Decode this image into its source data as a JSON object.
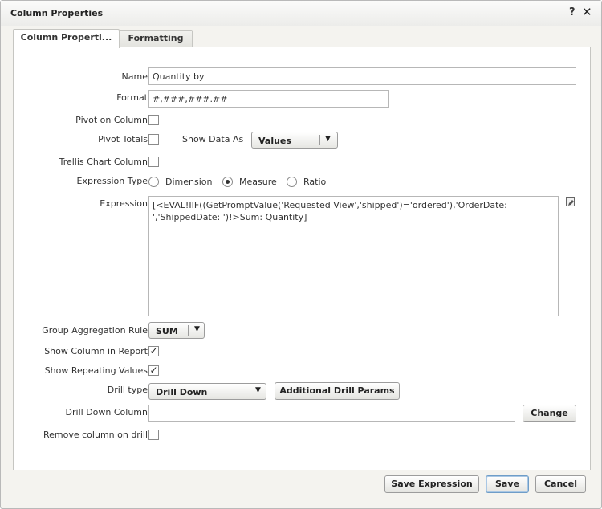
{
  "dialog": {
    "title": "Column Properties",
    "help_icon": "?",
    "close_icon": "✕"
  },
  "tabs": [
    {
      "label": "Column Properti..."
    },
    {
      "label": "Formatting"
    }
  ],
  "form": {
    "name": {
      "label": "Name",
      "value": "Quantity by"
    },
    "format": {
      "label": "Format",
      "value": "#,###,###.##"
    },
    "pivot_on_column": {
      "label": "Pivot on Column",
      "checked": false
    },
    "pivot_totals": {
      "label": "Pivot Totals",
      "checked": false
    },
    "show_data_as": {
      "label": "Show Data As",
      "value": "Values"
    },
    "trellis_chart_column": {
      "label": "Trellis Chart Column",
      "checked": false
    },
    "expression_type": {
      "label": "Expression Type",
      "options": [
        "Dimension",
        "Measure",
        "Ratio"
      ],
      "selected": "Measure"
    },
    "expression": {
      "label": "Expression",
      "line1": "[<EVAL!IIF((GetPromptValue('Requested View','shipped')='ordered'),'OrderDate:",
      "line2": "','ShippedDate: ')!>Sum: Quantity]"
    },
    "group_aggregation_rule": {
      "label": "Group Aggregation Rule",
      "value": "SUM"
    },
    "show_column_in_report": {
      "label": "Show Column in Report",
      "checked": true
    },
    "show_repeating_values": {
      "label": "Show Repeating Values",
      "checked": true
    },
    "drill_type": {
      "label": "Drill type",
      "value": "Drill Down"
    },
    "additional_drill_params": {
      "label": "Additional Drill Params"
    },
    "drill_down_column": {
      "label": "Drill Down Column",
      "value": ""
    },
    "change_button": {
      "label": "Change"
    },
    "remove_column_on_drill": {
      "label": "Remove column on drill",
      "checked": false
    }
  },
  "footer": {
    "save_expression": "Save Expression",
    "save": "Save",
    "cancel": "Cancel"
  },
  "icons": {
    "check_mark": "✓",
    "dropdown_arrow": "▼"
  },
  "colors": {
    "primary_button_border": "#6f9dc8",
    "panel_bg": "#f4f3ef"
  }
}
